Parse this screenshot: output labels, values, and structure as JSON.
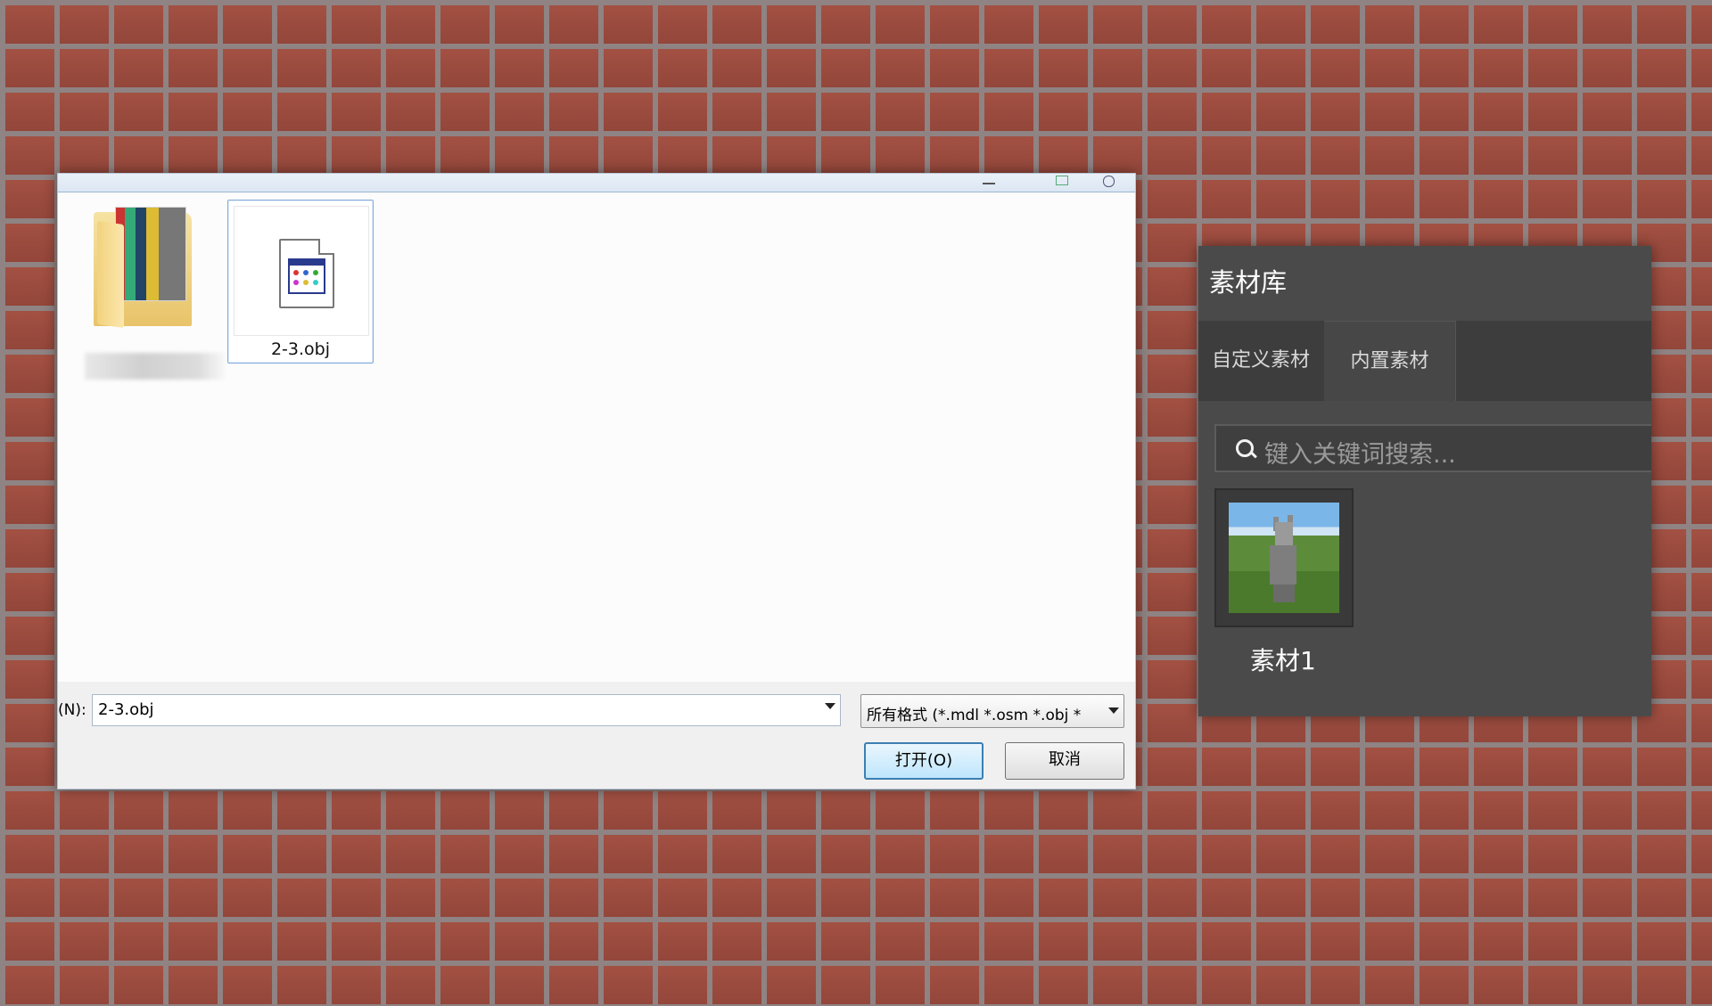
{
  "file_dialog": {
    "files": [
      {
        "name": "",
        "type": "folder"
      },
      {
        "name": "2-3.obj",
        "type": "obj-file"
      }
    ],
    "filename_label": "(N):",
    "filename_value": "2-3.obj",
    "filetype_value": "所有格式 (*.mdl *.osm *.obj *",
    "open_button": "打开(O)",
    "cancel_button": "取消"
  },
  "material_library": {
    "title": "素材库",
    "tabs": [
      {
        "label": "自定义素材",
        "active": true
      },
      {
        "label": "内置素材",
        "active": false
      }
    ],
    "search_placeholder": "键入关键词搜索...",
    "assets": [
      {
        "label": "素材1"
      }
    ]
  },
  "colors": {
    "brick": "#9c4b3c",
    "mortar": "#8f8383",
    "panel_bg": "#4a4a4a",
    "accent_blue": "#3c7fb1"
  }
}
